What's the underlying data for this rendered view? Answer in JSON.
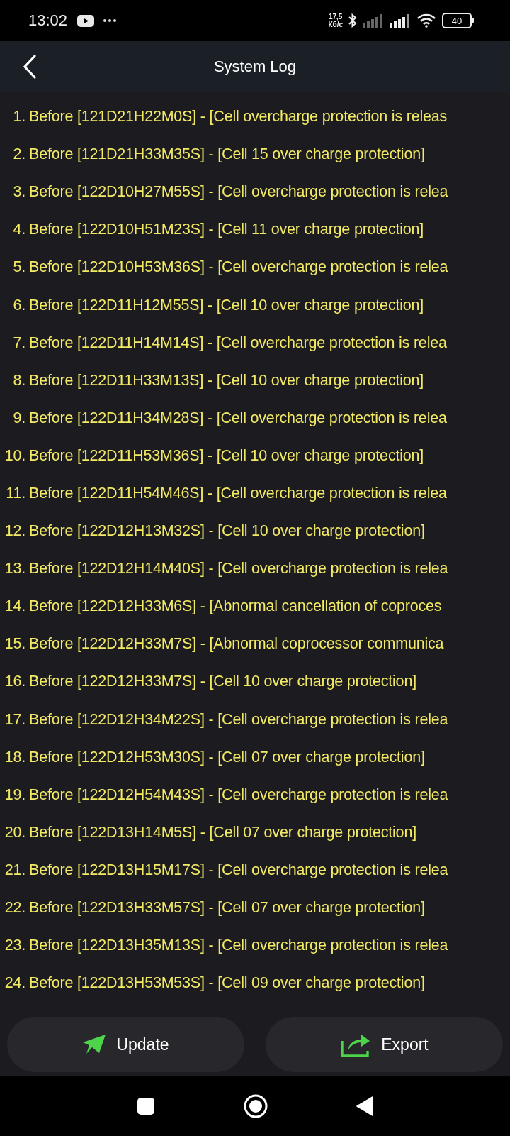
{
  "status_bar": {
    "time": "13:02",
    "net_speed": "17,5",
    "net_unit": "Кб/с",
    "battery": "40"
  },
  "header": {
    "title": "System Log"
  },
  "entries": [
    {
      "number": "1.",
      "text": "Before [121D21H22M0S] - [Cell overcharge protection is releas"
    },
    {
      "number": "2.",
      "text": "Before [121D21H33M35S] - [Cell 15 over charge protection]"
    },
    {
      "number": "3.",
      "text": "Before [122D10H27M55S] - [Cell overcharge protection is relea"
    },
    {
      "number": "4.",
      "text": "Before [122D10H51M23S] - [Cell 11 over charge protection]"
    },
    {
      "number": "5.",
      "text": "Before [122D10H53M36S] - [Cell overcharge protection is relea"
    },
    {
      "number": "6.",
      "text": "Before [122D11H12M55S] - [Cell 10 over charge protection]"
    },
    {
      "number": "7.",
      "text": "Before [122D11H14M14S] - [Cell overcharge protection is relea"
    },
    {
      "number": "8.",
      "text": "Before [122D11H33M13S] - [Cell 10 over charge protection]"
    },
    {
      "number": "9.",
      "text": "Before [122D11H34M28S] - [Cell overcharge protection is relea"
    },
    {
      "number": "10.",
      "text": "Before [122D11H53M36S] - [Cell 10 over charge protection]"
    },
    {
      "number": "11.",
      "text": "Before [122D11H54M46S] - [Cell overcharge protection is relea"
    },
    {
      "number": "12.",
      "text": "Before [122D12H13M32S] - [Cell 10 over charge protection]"
    },
    {
      "number": "13.",
      "text": "Before [122D12H14M40S] - [Cell overcharge protection is relea"
    },
    {
      "number": "14.",
      "text": "Before [122D12H33M6S] - [Abnormal cancellation of coproces"
    },
    {
      "number": "15.",
      "text": "Before [122D12H33M7S] - [Abnormal coprocessor communica"
    },
    {
      "number": "16.",
      "text": "Before [122D12H33M7S] - [Cell 10 over charge protection]"
    },
    {
      "number": "17.",
      "text": "Before [122D12H34M22S] - [Cell overcharge protection is relea"
    },
    {
      "number": "18.",
      "text": "Before [122D12H53M30S] - [Cell 07 over charge protection]"
    },
    {
      "number": "19.",
      "text": "Before [122D12H54M43S] - [Cell overcharge protection is relea"
    },
    {
      "number": "20.",
      "text": "Before [122D13H14M5S] - [Cell 07 over charge protection]"
    },
    {
      "number": "21.",
      "text": "Before [122D13H15M17S] - [Cell overcharge protection is relea"
    },
    {
      "number": "22.",
      "text": "Before [122D13H33M57S] - [Cell 07 over charge protection]"
    },
    {
      "number": "23.",
      "text": "Before [122D13H35M13S] - [Cell overcharge protection is relea"
    },
    {
      "number": "24.",
      "text": "Before [122D13H53M53S] - [Cell 09 over charge protection]"
    }
  ],
  "buttons": [
    {
      "label": "Update",
      "kind": "update"
    },
    {
      "label": "Export",
      "kind": "export"
    }
  ]
}
